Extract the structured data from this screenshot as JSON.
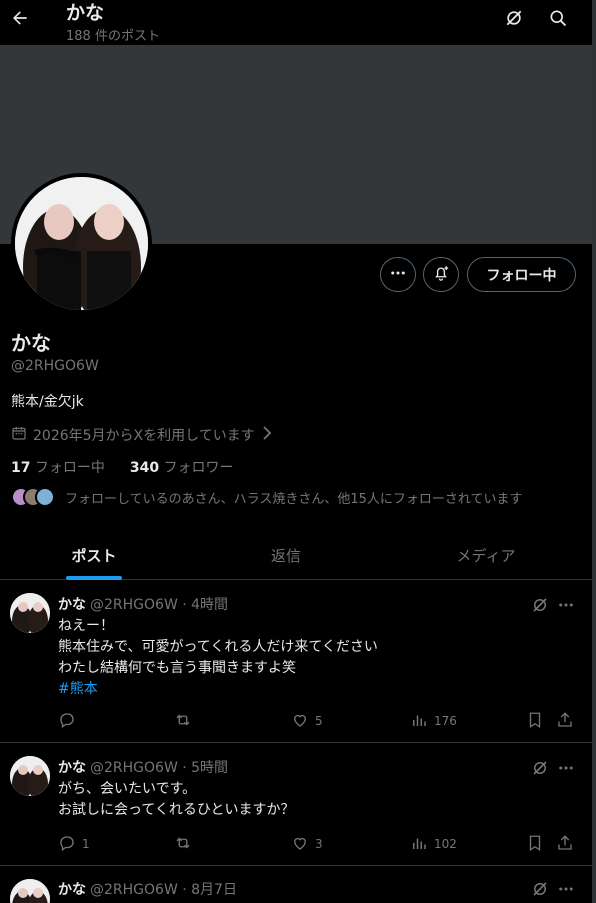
{
  "header": {
    "title": "かな",
    "subtitle": "188 件のポスト"
  },
  "profile": {
    "name": "かな",
    "handle": "@2RHGO6W",
    "bio": "熊本/金欠jk",
    "joined": "2026年5月からXを利用しています",
    "following_count": "17",
    "following_label": " フォロー中",
    "followers_count": "340",
    "followers_label": " フォロワー",
    "followed_by": "フォローしているのあさん、ハラス焼きさん、他15人にフォローされています",
    "follow_button": "フォロー中"
  },
  "tabs": [
    {
      "label": "ポスト"
    },
    {
      "label": "返信"
    },
    {
      "label": "メディア"
    }
  ],
  "posts": [
    {
      "name": "かな",
      "meta": "@2RHGO6W · 4時間",
      "lines": [
        "ねえー！",
        "熊本住みで、可愛がってくれる人だけ来てください",
        "わたし結構何でも言う事聞きますよ笑"
      ],
      "hashtag": "#熊本",
      "replies": "",
      "reposts": "",
      "likes": "5",
      "views": "176"
    },
    {
      "name": "かな",
      "meta": "@2RHGO6W · 5時間",
      "lines": [
        "がち、会いたいです。",
        "お試しに会ってくれるひといますか？"
      ],
      "replies": "1",
      "reposts": "",
      "likes": "3",
      "views": "102"
    },
    {
      "name": "かな",
      "meta": "@2RHGO6W · 8月7日"
    }
  ],
  "colors": {
    "accent": "#1d9bf0",
    "banner": "#33373a",
    "muted": "#71767b"
  },
  "icons": [
    "back-arrow-icon",
    "grok-icon",
    "search-icon",
    "more-icon",
    "bell-plus-icon",
    "calendar-icon",
    "chevron-right-icon",
    "reply-icon",
    "repost-icon",
    "like-icon",
    "views-icon",
    "bookmark-icon",
    "share-icon"
  ]
}
